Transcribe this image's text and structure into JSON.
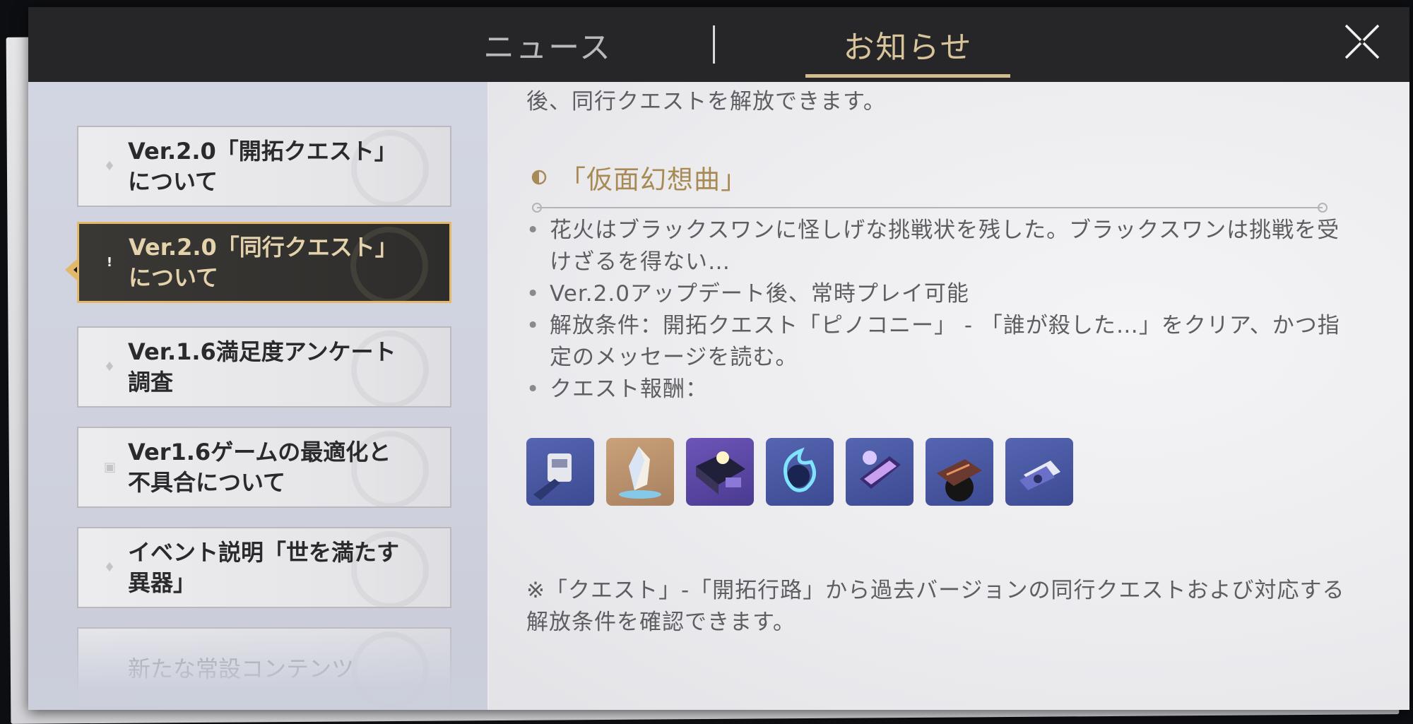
{
  "tabs": {
    "news": "ニュース",
    "notice": "お知らせ"
  },
  "list": {
    "items": [
      {
        "label": "Ver.2.0「開拓クエスト」について"
      },
      {
        "label": "Ver.2.0「同行クエスト」について"
      },
      {
        "label": "Ver.1.6満足度アンケート調査"
      },
      {
        "label": "Ver1.6ゲームの最適化と不具合について"
      },
      {
        "label": "イベント説明「世を満たす異器」"
      },
      {
        "label": "新たな常設コンテンツ"
      }
    ],
    "active_index": 1
  },
  "content": {
    "top_line": "後、同行クエストを解放できます。",
    "section_title": "「仮面幻想曲」",
    "bullets": [
      "花火はブラックスワンに怪しげな挑戦状を残した。ブラックスワンは挑戦を受けざるを得ない…",
      "Ver.2.0アップデート後、常時プレイ可能",
      "解放条件：開拓クエスト「ピノコニー」 - 「誰が殺した…」をクリア、かつ指定のメッセージを読む。",
      "クエスト報酬："
    ],
    "rewards": [
      {
        "icon": "credit-device-icon",
        "bg": "blue"
      },
      {
        "icon": "crystal-icon",
        "bg": "gold"
      },
      {
        "icon": "exp-book-icon",
        "bg": "purple"
      },
      {
        "icon": "blue-flame-orb-icon",
        "bg": "blue"
      },
      {
        "icon": "ticket-icon",
        "bg": "blue"
      },
      {
        "icon": "record-album-icon",
        "bg": "blue"
      },
      {
        "icon": "card-icon",
        "bg": "blue"
      }
    ],
    "footnote": "※「クエスト」-「開拓行路」から過去バージョンの同行クエストおよび対応する解放条件を確認できます。"
  },
  "colors": {
    "accent_gold": "#d4bd8c",
    "active_border": "#e2b86a",
    "section_title": "#a88a55"
  }
}
